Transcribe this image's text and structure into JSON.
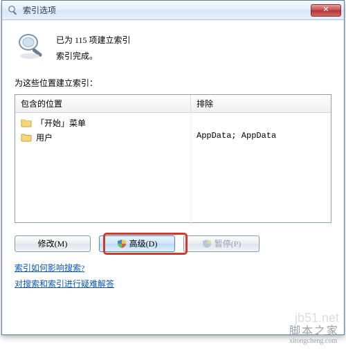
{
  "window": {
    "title": "索引选项",
    "close_label": "✕"
  },
  "status": {
    "line1": "已为 115 项建立索引",
    "line2": "索引完成。"
  },
  "prompt": "为这些位置建立索引：",
  "columns": {
    "c1": "包含的位置",
    "c2": "排除"
  },
  "rows": {
    "r1": {
      "label": "「开始」菜单",
      "exclude": ""
    },
    "r2": {
      "label": "用户",
      "exclude": "AppData; AppData"
    }
  },
  "buttons": {
    "modify": "修改(M)",
    "advanced": "高级(D)",
    "pause": "暂停(P)"
  },
  "links": {
    "l1": "索引如何影响搜索?",
    "l2": "对搜索和索引进行疑难解答"
  },
  "watermark": {
    "w1": "jb51.net",
    "w2": "脚本之家",
    "w2sub": "xitongcheng.com"
  }
}
